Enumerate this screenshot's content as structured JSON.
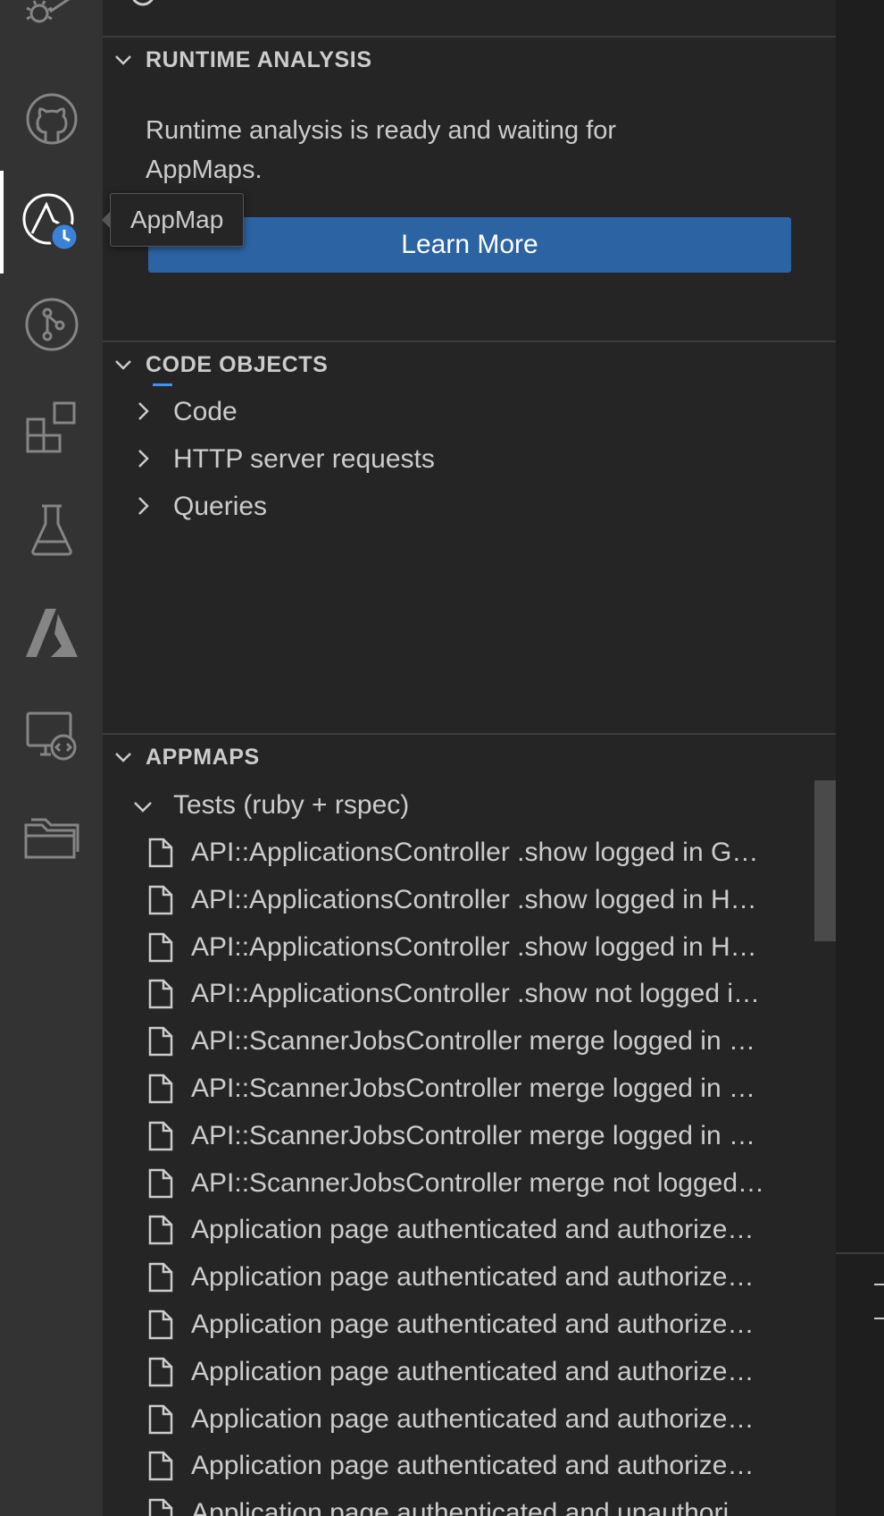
{
  "activity_bar": {
    "items": [
      {
        "icon": "run-debug-icon"
      },
      {
        "icon": "github-icon"
      },
      {
        "icon": "appmap-icon",
        "active": true
      },
      {
        "icon": "source-control-icon"
      },
      {
        "icon": "extensions-icon"
      },
      {
        "icon": "testing-icon"
      },
      {
        "icon": "azure-icon"
      },
      {
        "icon": "remote-explorer-icon"
      },
      {
        "icon": "folders-icon"
      }
    ],
    "tooltip": "AppMap"
  },
  "runtime_analysis": {
    "title": "RUNTIME ANALYSIS",
    "message": "Runtime analysis is ready and waiting for AppMaps.",
    "button_label": "Learn More"
  },
  "code_objects": {
    "title": "CODE OBJECTS",
    "items": [
      {
        "label": "Code"
      },
      {
        "label": "HTTP server requests"
      },
      {
        "label": "Queries"
      }
    ]
  },
  "appmaps": {
    "title": "APPMAPS",
    "group_label": "Tests (ruby + rspec)",
    "files": [
      "API::ApplicationsController .show logged in G…",
      "API::ApplicationsController .show logged in H…",
      "API::ApplicationsController .show logged in H…",
      "API::ApplicationsController .show not logged i…",
      "API::ScannerJobsController merge logged in …",
      "API::ScannerJobsController merge logged in …",
      "API::ScannerJobsController merge logged in …",
      "API::ScannerJobsController merge not logged…",
      "Application page authenticated and authorize…",
      "Application page authenticated and authorize…",
      "Application page authenticated and authorize…",
      "Application page authenticated and authorize…",
      "Application page authenticated and authorize…",
      "Application page authenticated and authorize…",
      "Application page authenticated and unauthori…"
    ]
  },
  "colors": {
    "activity_bar_bg": "#333333",
    "panel_bg": "#252526",
    "button_bg": "#2c64a3",
    "badge_blue": "#3b82d6"
  }
}
